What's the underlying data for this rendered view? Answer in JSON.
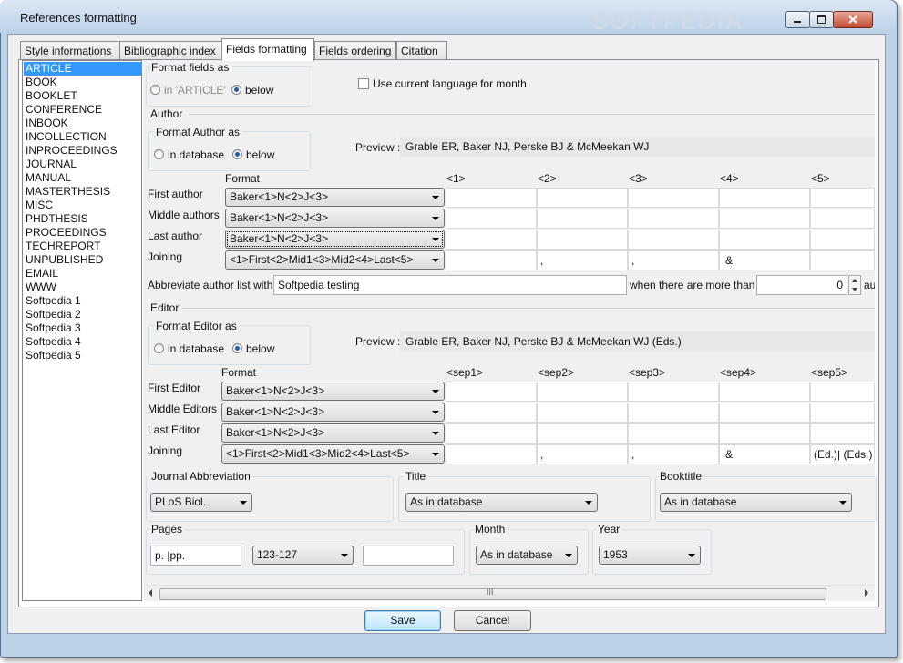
{
  "window": {
    "title": "References formatting",
    "watermark": "SOFTPEDIA"
  },
  "tabs": [
    "Style informations",
    "Bibliographic index",
    "Fields formatting",
    "Fields ordering",
    "Citation"
  ],
  "entry_types": [
    "ARTICLE",
    "BOOK",
    "BOOKLET",
    "CONFERENCE",
    "INBOOK",
    "INCOLLECTION",
    "INPROCEEDINGS",
    "JOURNAL",
    "MANUAL",
    "MASTERTHESIS",
    "MISC",
    "PHDTHESIS",
    "PROCEEDINGS",
    "TECHREPORT",
    "UNPUBLISHED",
    "EMAIL",
    "WWW",
    "Softpedia 1",
    "Softpedia 2",
    "Softpedia 3",
    "Softpedia 4",
    "Softpedia 5"
  ],
  "format_fields": {
    "legend": "Format fields as",
    "opt1": "in 'ARTICLE'",
    "opt2": "below",
    "use_language": "Use current language for month"
  },
  "author": {
    "section": "Author",
    "legend": "Format Author as",
    "opt1": "in database",
    "opt2": "below",
    "preview_label": "Preview :",
    "preview": "Grable ER, Baker NJ, Perske BJ & McMeekan WJ",
    "format_header": "Format",
    "cols": [
      "<1>",
      "<2>",
      "<3>",
      "<4>",
      "<5>"
    ],
    "rows": [
      {
        "label": "First author",
        "format": "Baker<1>N<2>J<3>",
        "cells": [
          "",
          "",
          "",
          "",
          ""
        ]
      },
      {
        "label": "Middle authors",
        "format": "Baker<1>N<2>J<3>",
        "cells": [
          "",
          "",
          "",
          "",
          ""
        ]
      },
      {
        "label": "Last author",
        "format": "Baker<1>N<2>J<3>",
        "cells": [
          "",
          "",
          "",
          "",
          ""
        ]
      },
      {
        "label": "Joining",
        "format": "<1>First<2>Mid1<3>Mid2<4>Last<5>",
        "cells": [
          "",
          ",",
          ",",
          "&",
          ""
        ]
      }
    ],
    "abbrev_label": "Abbreviate author list with",
    "abbrev_value": "Softpedia testing",
    "more_than_label": "when there are more than",
    "more_than_value": "0",
    "trailing": "au"
  },
  "editor": {
    "section": "Editor",
    "legend": "Format Editor as",
    "opt1": "in database",
    "opt2": "below",
    "preview_label": "Preview :",
    "preview": "Grable ER, Baker NJ, Perske BJ & McMeekan WJ (Eds.)",
    "format_header": "Format",
    "cols": [
      "<sep1>",
      "<sep2>",
      "<sep3>",
      "<sep4>",
      "<sep5>"
    ],
    "rows": [
      {
        "label": "First Editor",
        "format": "Baker<1>N<2>J<3>",
        "cells": [
          "",
          "",
          "",
          "",
          ""
        ]
      },
      {
        "label": "Middle Editors",
        "format": "Baker<1>N<2>J<3>",
        "cells": [
          "",
          "",
          "",
          "",
          ""
        ]
      },
      {
        "label": "Last Editor",
        "format": "Baker<1>N<2>J<3>",
        "cells": [
          "",
          "",
          "",
          "",
          ""
        ]
      },
      {
        "label": "Joining",
        "format": "<1>First<2>Mid1<3>Mid2<4>Last<5>",
        "cells": [
          "",
          ",",
          ",",
          "&",
          "(Ed.)| (Eds.)"
        ]
      }
    ]
  },
  "journal": {
    "legend": "Journal Abbreviation",
    "value": "PLoS Biol."
  },
  "title_group": {
    "legend": "Title",
    "value": "As in database"
  },
  "booktitle": {
    "legend": "Booktitle",
    "value": "As in database"
  },
  "pages": {
    "legend": "Pages",
    "prefix": "p. |pp.",
    "format": "123-127",
    "suffix": ""
  },
  "month": {
    "legend": "Month",
    "value": "As in database"
  },
  "year": {
    "legend": "Year",
    "value": "1953"
  },
  "scrollbar": {
    "grip": "III"
  },
  "buttons": {
    "save": "Save",
    "cancel": "Cancel"
  }
}
